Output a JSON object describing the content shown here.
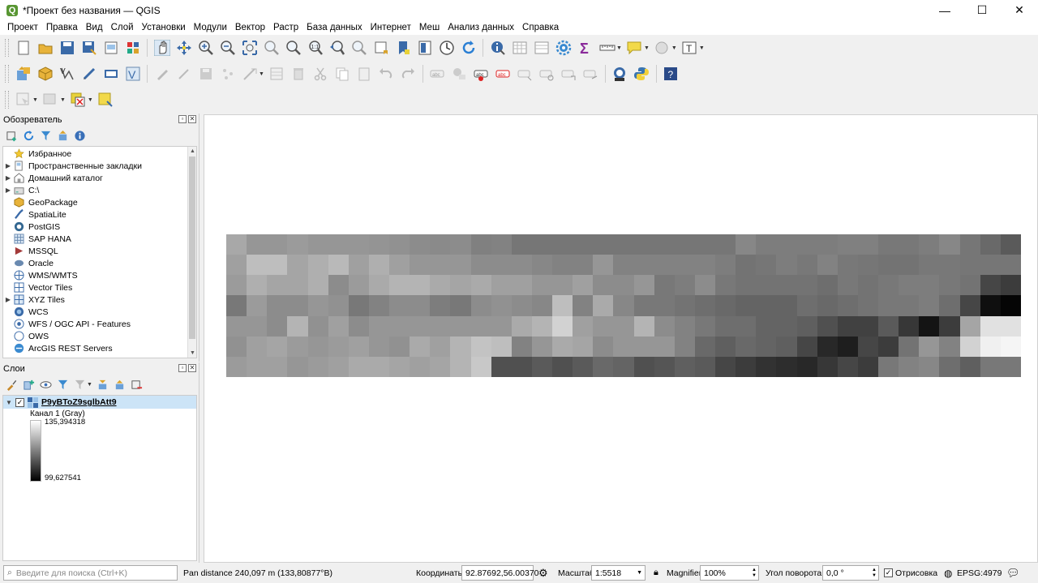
{
  "window": {
    "title": "*Проект без названия — QGIS",
    "minimize": "—",
    "maximize": "☐",
    "close": "✕"
  },
  "menu": [
    "Проект",
    "Правка",
    "Вид",
    "Слой",
    "Установки",
    "Модули",
    "Вектор",
    "Растр",
    "База данных",
    "Интернет",
    "Меш",
    "Анализ данных",
    "Справка"
  ],
  "toolbars": {
    "row1": [
      "new-project-icon",
      "open-project-icon",
      "save-project-icon",
      "save-as-icon",
      "print-layout-icon",
      "style-manager-icon",
      "sep",
      "pan-icon",
      "pan-to-selection-icon",
      "zoom-in-icon",
      "zoom-out-icon",
      "zoom-full-icon",
      "zoom-to-selection-icon",
      "zoom-to-layer-icon",
      "zoom-native-icon",
      "zoom-last-icon",
      "zoom-next-icon",
      "new-bookmark-icon",
      "show-bookmarks-icon",
      "new-map-view-icon",
      "temporal-icon",
      "refresh-icon",
      "sep",
      "identify-icon",
      "open-table-icon",
      "statistics-icon",
      "settings-gear-icon",
      "sigma-icon",
      "measure-icon",
      "annotation-icon",
      "plugin-icon",
      "text-annotation-icon"
    ],
    "row2": [
      "data-source-manager-icon",
      "new-geopackage-icon",
      "new-vector-icon",
      "digitize-icon",
      "georeferencer-icon",
      "vector-validate-icon",
      "sep",
      "edit-pencil-icon",
      "toggle-edit-icon",
      "save-edits-icon",
      "add-feature-icon",
      "vertex-tool-icon",
      "modify-attributes-icon",
      "delete-icon",
      "cut-icon",
      "copy-icon",
      "paste-icon",
      "undo-icon",
      "redo-icon",
      "sep",
      "label-icon",
      "label-pin-icon",
      "label-highlight-icon",
      "label-abc-icon",
      "label-move-icon",
      "label-rotate-icon",
      "label-change-icon",
      "label-show-icon",
      "sep",
      "plugin-manager-icon",
      "python-icon",
      "sep",
      "help-icon"
    ],
    "row3": [
      "select-feature-icon",
      "deselect-icon",
      "select-by-expression-icon",
      "select-all-icon"
    ]
  },
  "browser": {
    "title": "Обозреватель",
    "items": [
      {
        "label": "Избранное",
        "icon": "star-icon",
        "arrow": ""
      },
      {
        "label": "Пространственные закладки",
        "icon": "bookmark-icon",
        "arrow": "▶"
      },
      {
        "label": "Домашний каталог",
        "icon": "home-folder-icon",
        "arrow": "▶"
      },
      {
        "label": "C:\\",
        "icon": "drive-icon",
        "arrow": "▶"
      },
      {
        "label": "GeoPackage",
        "icon": "geopackage-icon",
        "arrow": ""
      },
      {
        "label": "SpatiaLite",
        "icon": "spatialite-icon",
        "arrow": ""
      },
      {
        "label": "PostGIS",
        "icon": "postgis-icon",
        "arrow": ""
      },
      {
        "label": "SAP HANA",
        "icon": "sap-hana-icon",
        "arrow": ""
      },
      {
        "label": "MSSQL",
        "icon": "mssql-icon",
        "arrow": ""
      },
      {
        "label": "Oracle",
        "icon": "oracle-icon",
        "arrow": ""
      },
      {
        "label": "WMS/WMTS",
        "icon": "wms-icon",
        "arrow": ""
      },
      {
        "label": "Vector Tiles",
        "icon": "vector-tiles-icon",
        "arrow": ""
      },
      {
        "label": "XYZ Tiles",
        "icon": "xyz-tiles-icon",
        "arrow": "▶"
      },
      {
        "label": "WCS",
        "icon": "wcs-icon",
        "arrow": ""
      },
      {
        "label": "WFS / OGC API - Features",
        "icon": "wfs-icon",
        "arrow": ""
      },
      {
        "label": "OWS",
        "icon": "ows-icon",
        "arrow": ""
      },
      {
        "label": "ArcGIS REST Servers",
        "icon": "arcgis-icon",
        "arrow": ""
      }
    ]
  },
  "layers": {
    "title": "Слои",
    "layer_name": "P9yBToZ9sglbAtt9",
    "band": "Канал 1 (Gray)",
    "max": "135,394318",
    "min": "99,627541"
  },
  "raster": {
    "cols": 39,
    "rows": 7,
    "gray": [
      [
        168,
        150,
        150,
        155,
        150,
        150,
        150,
        148,
        145,
        140,
        138,
        140,
        128,
        130,
        118,
        118,
        118,
        118,
        118,
        118,
        118,
        118,
        118,
        118,
        118,
        135,
        125,
        125,
        125,
        125,
        128,
        128,
        120,
        120,
        125,
        135,
        118,
        105,
        90
      ],
      [
        160,
        190,
        190,
        165,
        175,
        185,
        160,
        175,
        160,
        150,
        150,
        150,
        140,
        140,
        140,
        135,
        130,
        130,
        150,
        130,
        130,
        130,
        130,
        130,
        125,
        115,
        118,
        125,
        120,
        130,
        120,
        118,
        115,
        115,
        120,
        120,
        118,
        118,
        118
      ],
      [
        155,
        175,
        165,
        165,
        175,
        140,
        155,
        170,
        180,
        180,
        170,
        165,
        170,
        160,
        160,
        150,
        150,
        160,
        140,
        140,
        150,
        120,
        125,
        140,
        120,
        115,
        115,
        115,
        115,
        110,
        120,
        115,
        120,
        125,
        125,
        120,
        115,
        70,
        60
      ],
      [
        120,
        155,
        140,
        140,
        150,
        145,
        120,
        130,
        140,
        140,
        125,
        120,
        140,
        145,
        140,
        135,
        190,
        130,
        170,
        135,
        120,
        120,
        115,
        110,
        105,
        100,
        100,
        100,
        110,
        105,
        110,
        115,
        120,
        120,
        125,
        110,
        70,
        15,
        5
      ],
      [
        150,
        150,
        140,
        180,
        145,
        160,
        140,
        150,
        150,
        150,
        150,
        150,
        150,
        150,
        170,
        180,
        210,
        160,
        150,
        150,
        180,
        140,
        130,
        120,
        110,
        110,
        100,
        100,
        95,
        80,
        65,
        65,
        90,
        55,
        20,
        60,
        165,
        225,
        225
      ],
      [
        145,
        160,
        165,
        155,
        150,
        155,
        160,
        150,
        145,
        170,
        160,
        180,
        195,
        190,
        130,
        150,
        170,
        165,
        140,
        150,
        150,
        150,
        130,
        105,
        95,
        105,
        100,
        95,
        70,
        40,
        30,
        70,
        60,
        115,
        150,
        130,
        210,
        240,
        245
      ],
      [
        155,
        160,
        160,
        150,
        155,
        160,
        170,
        170,
        165,
        160,
        165,
        180,
        200,
        80,
        80,
        90,
        80,
        90,
        105,
        100,
        80,
        85,
        95,
        90,
        70,
        60,
        50,
        45,
        40,
        55,
        70,
        60,
        120,
        130,
        135,
        110,
        95,
        120,
        120
      ]
    ]
  },
  "status": {
    "search_placeholder": "Введите для поиска (Ctrl+K)",
    "pan_message": "Pan distance 240,097 m (133,80877°B)",
    "coords_label": "Координаты",
    "coords_value": "92.87692,56.00370",
    "scale_label": "Масштаб",
    "scale_value": "1:5518",
    "magnifier_label": "Magnifier",
    "magnifier_value": "100%",
    "rotation_label": "Угол поворота",
    "rotation_value": "0,0 °",
    "render_label": "Отрисовка",
    "crs": "EPSG:4979"
  },
  "colors": {
    "accent": "#589632",
    "selection": "#cce4f7"
  }
}
